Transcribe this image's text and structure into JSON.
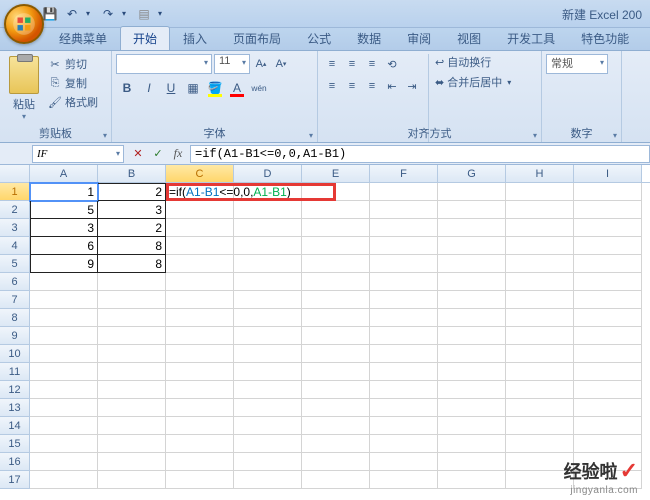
{
  "title": "新建 Excel 200",
  "tabs": [
    "经典菜单",
    "开始",
    "插入",
    "页面布局",
    "公式",
    "数据",
    "审阅",
    "视图",
    "开发工具",
    "特色功能"
  ],
  "active_tab_index": 1,
  "clipboard": {
    "paste": "粘贴",
    "cut": "剪切",
    "copy": "复制",
    "format_painter": "格式刷",
    "group_label": "剪贴板"
  },
  "font": {
    "name_placeholder": "",
    "size": "11",
    "group_label": "字体"
  },
  "alignment": {
    "wrap": "自动换行",
    "merge": "合并后居中",
    "group_label": "对齐方式"
  },
  "number": {
    "format": "常规",
    "group_label": "数字"
  },
  "namebox": "IF",
  "formula_bar": "=if(A1-B1<=0,0,A1-B1)",
  "editing_formula": {
    "pre": "=if(",
    "a": "A1-B1",
    "mid": "<=0,0,",
    "b": "A1-B1",
    "post": ")"
  },
  "columns": [
    "A",
    "B",
    "C",
    "D",
    "E",
    "F",
    "G",
    "H",
    "I"
  ],
  "rows": 17,
  "chart_data": {
    "type": "table",
    "columns": [
      "A",
      "B"
    ],
    "data": [
      {
        "A": 1,
        "B": 2
      },
      {
        "A": 5,
        "B": 3
      },
      {
        "A": 3,
        "B": 2
      },
      {
        "A": 6,
        "B": 8
      },
      {
        "A": 9,
        "B": 8
      }
    ]
  },
  "watermark": {
    "text": "经验啦",
    "sub": "jingyanla.com"
  }
}
